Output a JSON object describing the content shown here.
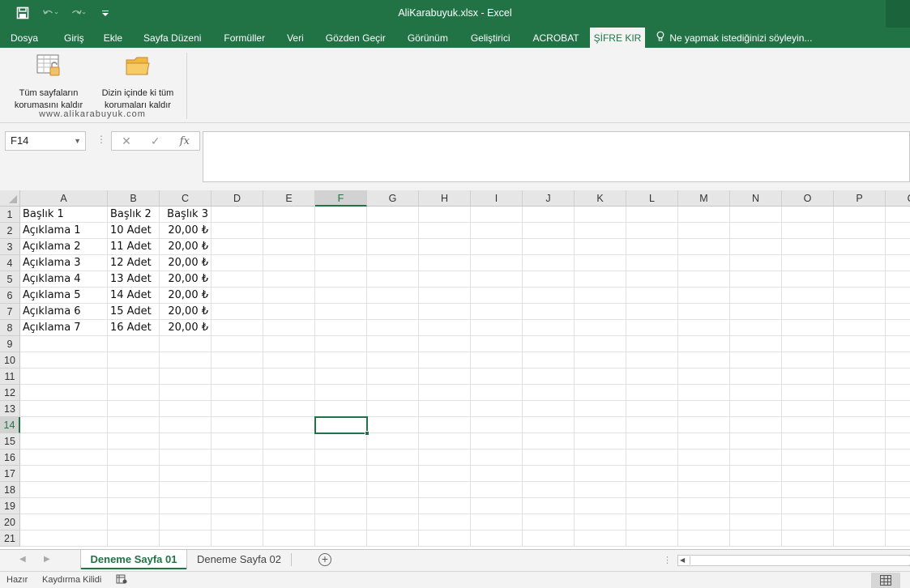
{
  "window": {
    "title": "AliKarabuyuk.xlsx - Excel"
  },
  "quick_access": {
    "icons": [
      "save-icon",
      "undo-icon",
      "redo-icon",
      "customize-icon"
    ]
  },
  "ribbon_tabs": [
    {
      "label": "Dosya",
      "active": false
    },
    {
      "label": "Giriş",
      "active": false
    },
    {
      "label": "Ekle",
      "active": false
    },
    {
      "label": "Sayfa Düzeni",
      "active": false
    },
    {
      "label": "Formüller",
      "active": false
    },
    {
      "label": "Veri",
      "active": false
    },
    {
      "label": "Gözden Geçir",
      "active": false
    },
    {
      "label": "Görünüm",
      "active": false
    },
    {
      "label": "Geliştirici",
      "active": false
    },
    {
      "label": "ACROBAT",
      "active": false
    },
    {
      "label": "ŞİFRE KIR",
      "active": true
    }
  ],
  "tell_me": {
    "placeholder": "Ne yapmak istediğinizi söyleyin..."
  },
  "ribbon": {
    "button1": {
      "line1": "Tüm sayfaların",
      "line2": "korumasını kaldır"
    },
    "button2": {
      "line1": "Dizin içinde ki tüm",
      "line2": "korumaları kaldır"
    },
    "group_label": "www.alikarabuyuk.com"
  },
  "formula_bar": {
    "name_box": "F14",
    "formula": ""
  },
  "columns": [
    "A",
    "B",
    "C",
    "D",
    "E",
    "F",
    "G",
    "H",
    "I",
    "J",
    "K",
    "L",
    "M",
    "N",
    "O",
    "P",
    "Q"
  ],
  "selected_column": "F",
  "selected_row": 14,
  "row_count": 21,
  "cells": [
    [
      "Başlık 1",
      "Başlık 2",
      "Başlık 3"
    ],
    [
      "Açıklama 1",
      "10 Adet",
      "20,00 ₺"
    ],
    [
      "Açıklama 2",
      "11 Adet",
      "20,00 ₺"
    ],
    [
      "Açıklama 3",
      "12 Adet",
      "20,00 ₺"
    ],
    [
      "Açıklama 4",
      "13 Adet",
      "20,00 ₺"
    ],
    [
      "Açıklama 5",
      "14 Adet",
      "20,00 ₺"
    ],
    [
      "Açıklama 6",
      "15 Adet",
      "20,00 ₺"
    ],
    [
      "Açıklama 7",
      "16 Adet",
      "20,00 ₺"
    ]
  ],
  "sheets": [
    {
      "label": "Deneme Sayfa 01",
      "active": true
    },
    {
      "label": "Deneme Sayfa 02",
      "active": false
    }
  ],
  "status": {
    "ready": "Hazır",
    "scroll_lock": "Kaydırma Kilidi"
  }
}
